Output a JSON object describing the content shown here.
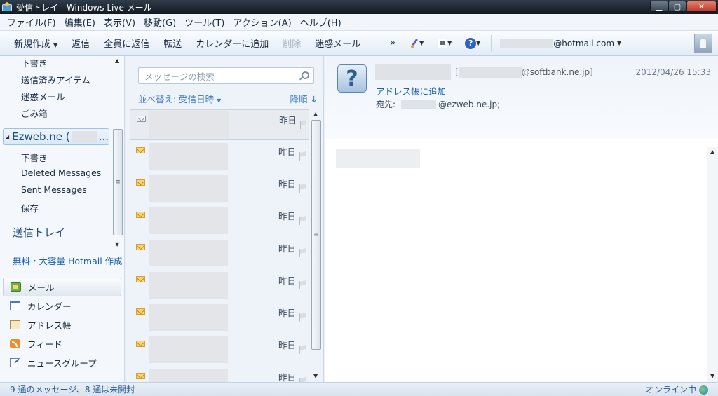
{
  "window": {
    "title": "受信トレイ - Windows Live メール",
    "minimize": "▁",
    "maximize": "▢",
    "close": "✕"
  },
  "menu": [
    "ファイル(F)",
    "編集(E)",
    "表示(V)",
    "移動(G)",
    "ツール(T)",
    "アクション(A)",
    "ヘルプ(H)"
  ],
  "toolbar": {
    "new_label": "新規作成",
    "reply": "返信",
    "reply_all": "全員に返信",
    "forward": "転送",
    "add_calendar": "カレンダーに追加",
    "delete": "削除",
    "junk": "迷惑メール",
    "more": "»",
    "account": "@hotmail.com"
  },
  "folders": {
    "drafts": "下書き",
    "sent_items": "送信済みアイテム",
    "junk": "迷惑メール",
    "trash": "ごみ箱",
    "account_name": "Ezweb.ne (",
    "account_tail": "...",
    "sub_drafts": "下書き",
    "deleted": "Deleted Messages",
    "sent": "Sent Messages",
    "saved": "保存",
    "outbox": "送信トレイ",
    "hotmail_link": "無料・大容量 Hotmail 作成"
  },
  "nav": {
    "mail": "メール",
    "calendar": "カレンダー",
    "contacts": "アドレス帳",
    "feeds": "フィード",
    "newsgroups": "ニュースグループ"
  },
  "message_list": {
    "search_placeholder": "メッセージの検索",
    "sort_label": "並べ替え: 受信日時",
    "order_label": "降順",
    "items": [
      {
        "date": "昨日"
      },
      {
        "date": "昨日"
      },
      {
        "date": "昨日"
      },
      {
        "date": "昨日"
      },
      {
        "date": "昨日"
      },
      {
        "date": "昨日"
      },
      {
        "date": "昨日"
      },
      {
        "date": "昨日"
      },
      {
        "date": "昨日"
      }
    ]
  },
  "reading": {
    "from_open": "[",
    "from_domain": "@softbank.ne.jp]",
    "date": "2012/04/26 15:33",
    "add_to_contacts": "アドレス帳に追加",
    "to_label": "宛先:",
    "to_domain": "@ezweb.ne.jp;"
  },
  "status": {
    "summary": "9 通のメッセージ、8 通は未開封",
    "online": "オンライン中"
  }
}
